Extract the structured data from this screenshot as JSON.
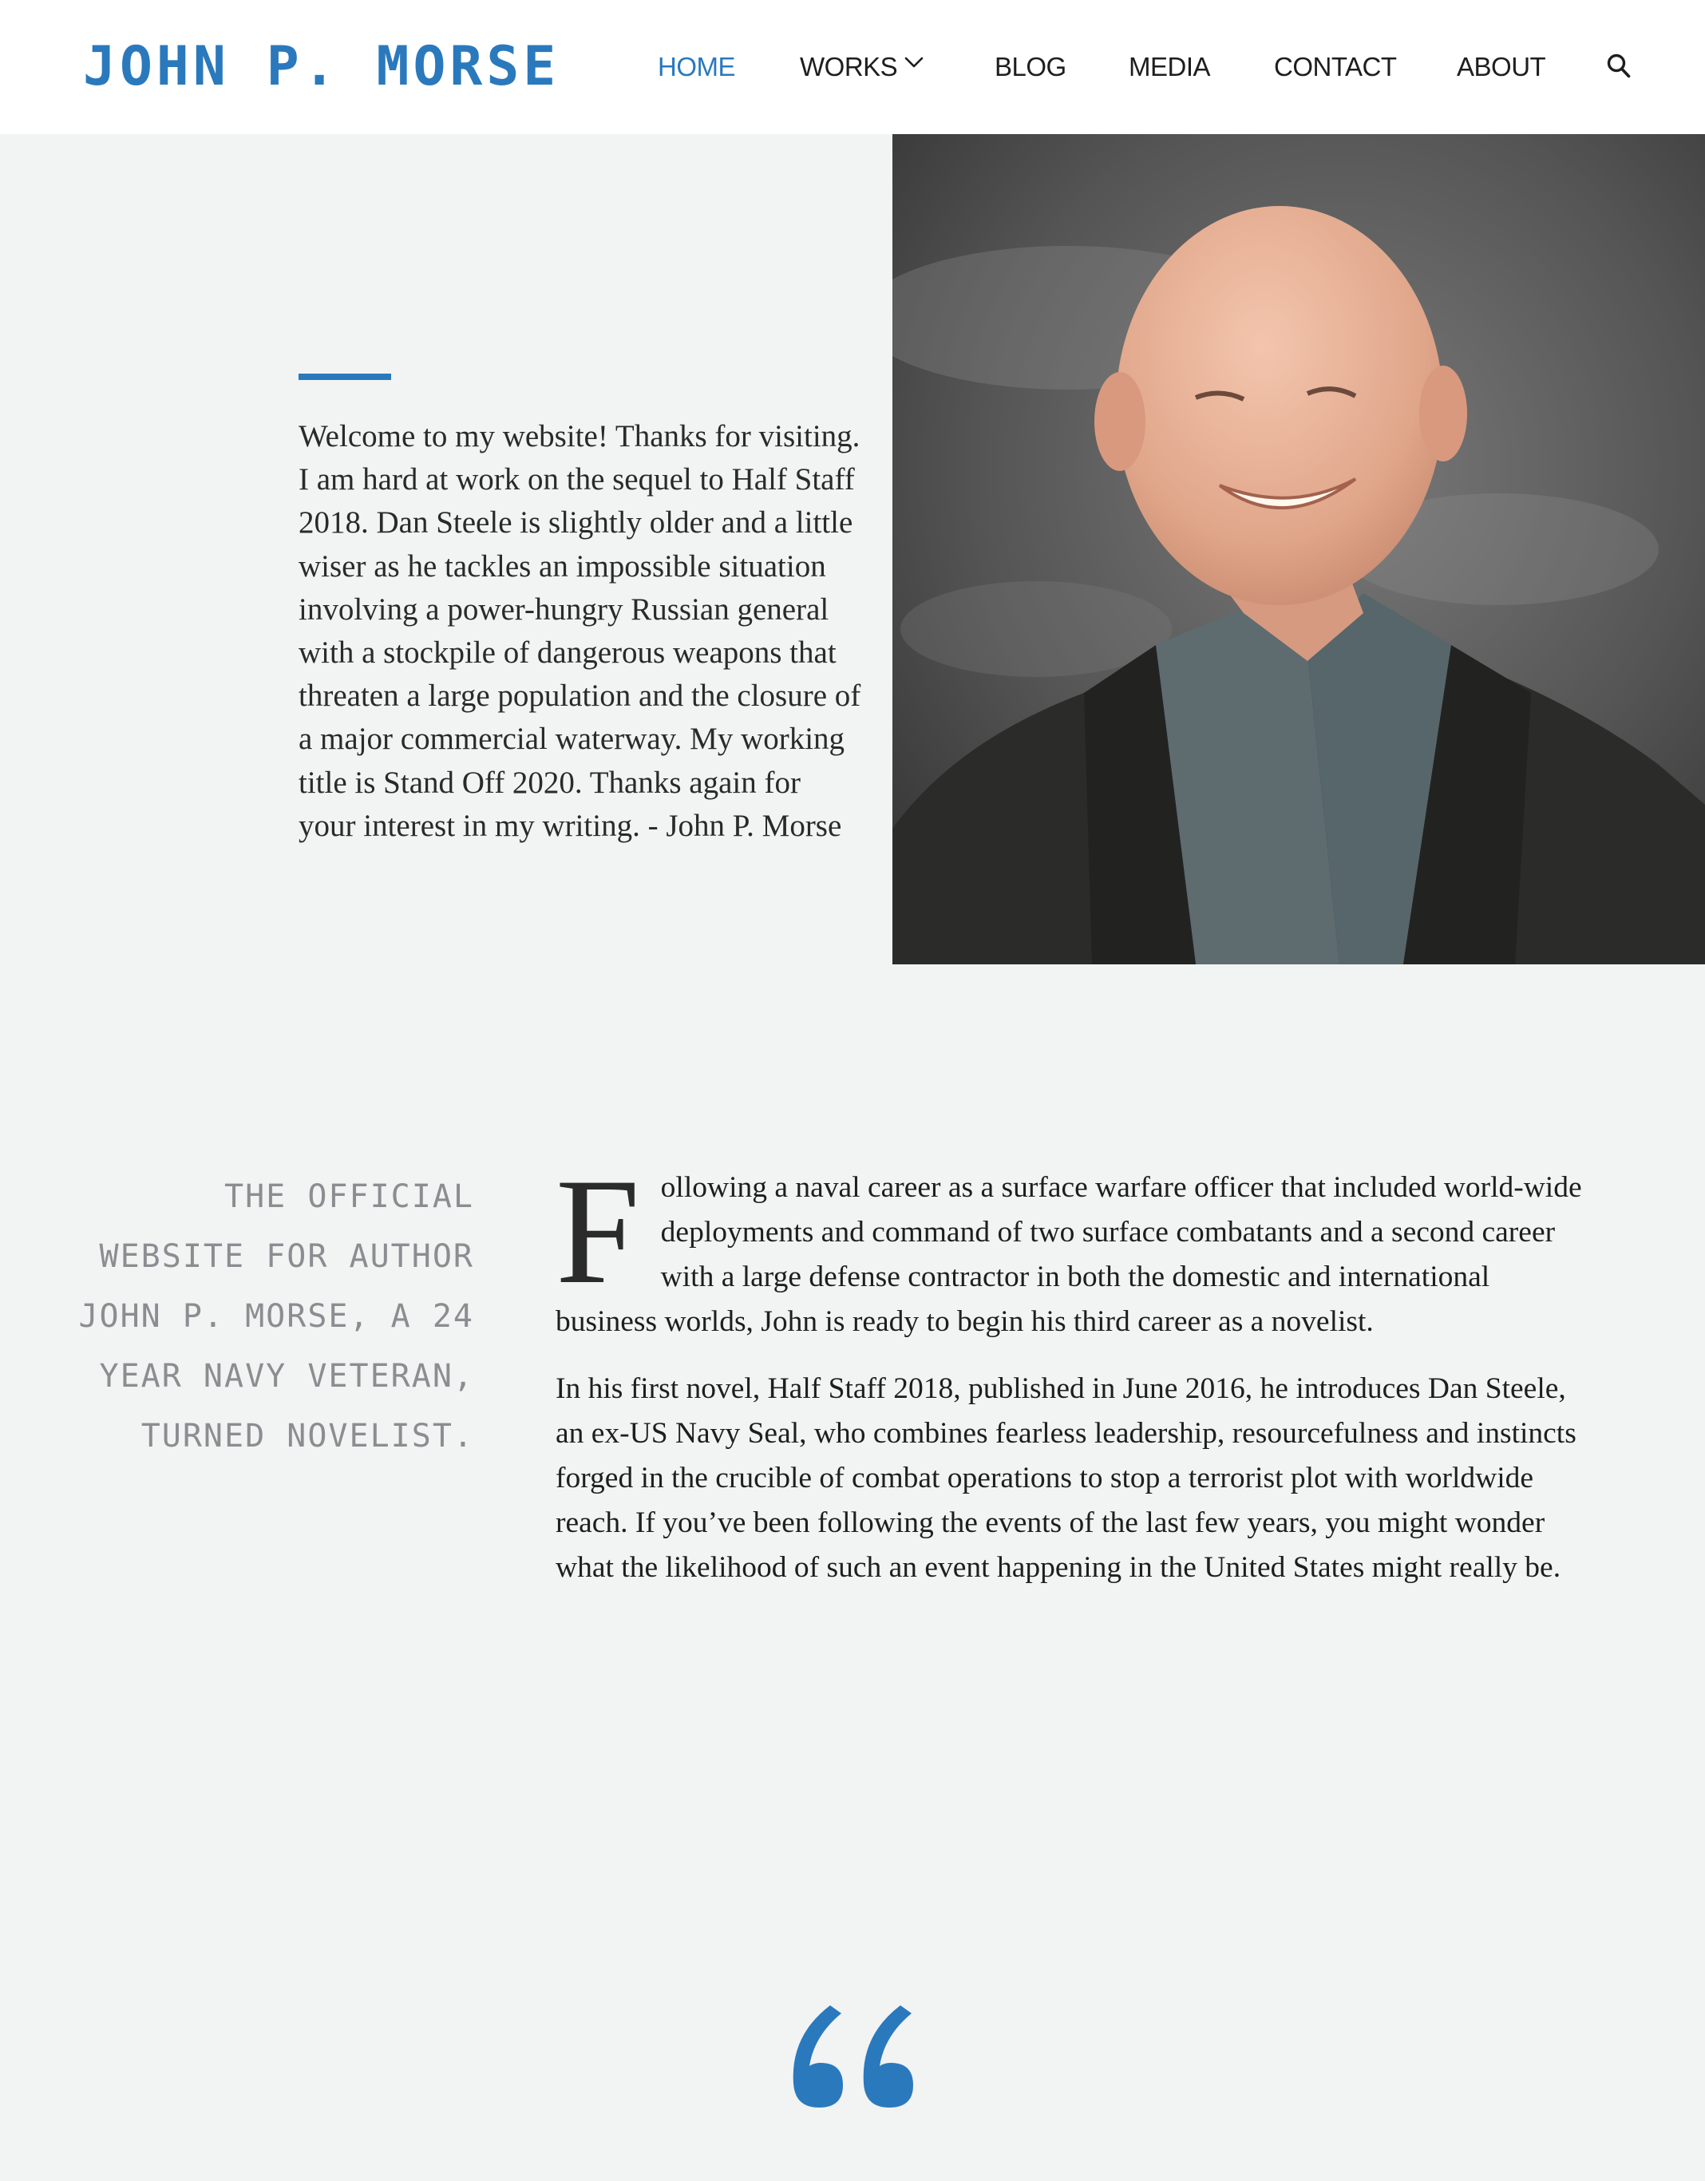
{
  "header": {
    "logo": "JOHN P. MORSE",
    "nav": {
      "home": "HOME",
      "works": "WORKS",
      "blog": "BLOG",
      "media": "MEDIA",
      "contact": "CONTACT",
      "about": "ABOUT"
    },
    "accent_color": "#2a79bd"
  },
  "hero": {
    "welcome_text": "Welcome to my website! Thanks for visiting. I am hard at work on the sequel to Half Staff 2018. Dan Steele is slightly older and a little wiser as he tackles an impossible situation involving a power-hungry Russian general with a stockpile of dangerous weapons that threaten a large population and the closure of a major commercial waterway. My working title is Stand Off 2020. Thanks again for your interest in my writing. - John P. Morse"
  },
  "bio": {
    "tagline": "THE OFFICIAL WEBSITE FOR AUTHOR JOHN P. MORSE, A 24 YEAR NAVY VETERAN, TURNED NOVELIST.",
    "dropcap": "F",
    "paragraph1_rest": "ollowing a naval career as a surface warfare officer that included world-wide deployments and command of two surface combatants and a second career with a large defense contractor in both the domestic and international business worlds, John is ready to begin his third career as a novelist.",
    "paragraph2": "In his first novel, Half Staff 2018, published in June 2016, he introduces Dan Steele, an ex-US Navy Seal, who combines fearless leadership, resourcefulness and instincts forged in the crucible of combat operations to stop a terrorist plot with worldwide reach. If you’ve been following the events of the last few years, you might wonder what the likelihood of such an event happening in the United States might really be."
  },
  "icons": {
    "works_dropdown": "chevron-down-icon",
    "search": "search-icon",
    "quote": "quote-icon"
  }
}
